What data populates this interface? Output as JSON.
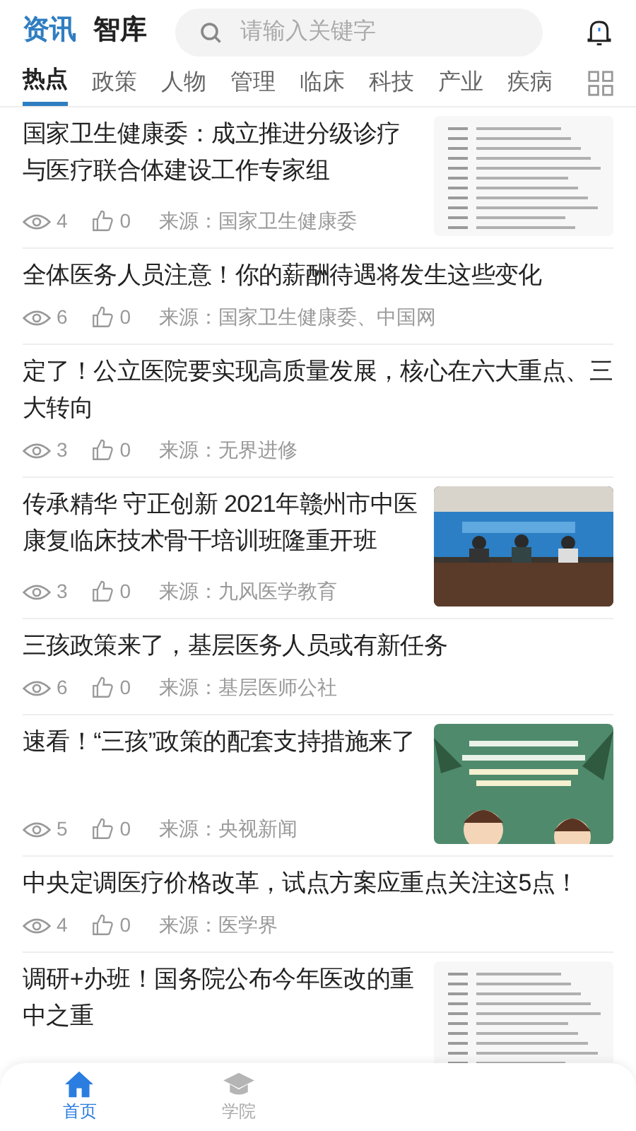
{
  "header": {
    "tabs": [
      {
        "label": "资讯",
        "selected": true
      },
      {
        "label": "智库",
        "selected": false
      }
    ],
    "search": {
      "placeholder": "请输入关键字"
    }
  },
  "categories": [
    {
      "label": "热点",
      "selected": true
    },
    {
      "label": "政策",
      "selected": false
    },
    {
      "label": "人物",
      "selected": false
    },
    {
      "label": "管理",
      "selected": false
    },
    {
      "label": "临床",
      "selected": false
    },
    {
      "label": "科技",
      "selected": false
    },
    {
      "label": "产业",
      "selected": false
    },
    {
      "label": "疾病",
      "selected": false
    }
  ],
  "articles": [
    {
      "title": "国家卫生健康委：成立推进分级诊疗与医疗联合体建设工作专家组",
      "views": "4",
      "likes": "0",
      "source": "来源：国家卫生健康委",
      "image": {
        "kind": "document"
      }
    },
    {
      "title": "全体医务人员注意！你的薪酬待遇将发生这些变化",
      "views": "6",
      "likes": "0",
      "source": "来源：国家卫生健康委、中国网"
    },
    {
      "title": "定了！公立医院要实现高质量发展，核心在六大重点、三大转向",
      "views": "3",
      "likes": "0",
      "source": "来源：无界进修"
    },
    {
      "title": "传承精华 守正创新 2021年赣州市中医康复临床技术骨干培训班隆重开班",
      "views": "3",
      "likes": "0",
      "source": "来源：九风医学教育",
      "image": {
        "kind": "meeting"
      }
    },
    {
      "title": "三孩政策来了，基层医务人员或有新任务",
      "views": "6",
      "likes": "0",
      "source": "来源：基层医师公社"
    },
    {
      "title": "速看！“三孩”政策的配套支持措施来了",
      "views": "5",
      "likes": "0",
      "source": "来源：央视新闻",
      "image": {
        "kind": "poster"
      }
    },
    {
      "title": "中央定调医疗价格改革，试点方案应重点关注这5点！",
      "views": "4",
      "likes": "0",
      "source": "来源：医学界"
    },
    {
      "title": "调研+办班！国务院公布今年医改的重中之重",
      "image": {
        "kind": "document"
      }
    }
  ],
  "bottom_nav": [
    {
      "label": "首页",
      "selected": true,
      "kind": "home"
    },
    {
      "label": "学院",
      "selected": false,
      "kind": "cap"
    }
  ]
}
